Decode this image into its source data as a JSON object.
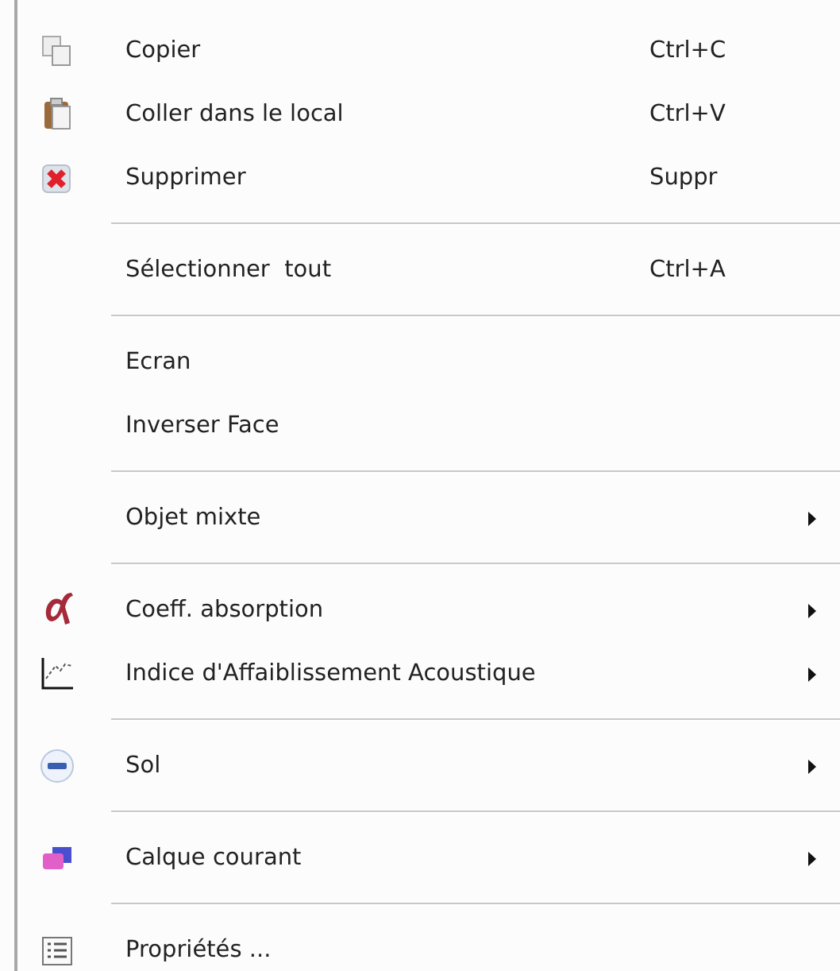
{
  "menu": [
    {
      "kind": "item",
      "label": "Copier",
      "shortcut": "Ctrl+C",
      "submenu": false
    },
    {
      "kind": "item",
      "label": "Coller dans le local",
      "shortcut": "Ctrl+V",
      "submenu": false
    },
    {
      "kind": "item",
      "label": "Supprimer",
      "shortcut": "Suppr",
      "submenu": false
    },
    {
      "kind": "separator"
    },
    {
      "kind": "item",
      "label": "Sélectionner  tout",
      "shortcut": "Ctrl+A",
      "submenu": false
    },
    {
      "kind": "separator"
    },
    {
      "kind": "item",
      "label": "Ecran",
      "submenu": false
    },
    {
      "kind": "item",
      "label": "Inverser Face",
      "submenu": false
    },
    {
      "kind": "separator"
    },
    {
      "kind": "item",
      "label": "Objet mixte",
      "submenu": true
    },
    {
      "kind": "separator"
    },
    {
      "kind": "item",
      "label": "Coeff. absorption",
      "submenu": true
    },
    {
      "kind": "item",
      "label": "Indice d'Affaiblissement Acoustique",
      "submenu": true
    },
    {
      "kind": "separator"
    },
    {
      "kind": "item",
      "label": "Sol",
      "submenu": true
    },
    {
      "kind": "separator"
    },
    {
      "kind": "item",
      "label": "Calque courant",
      "submenu": true
    },
    {
      "kind": "separator"
    },
    {
      "kind": "item",
      "label": "Propriétés ...",
      "submenu": false
    }
  ]
}
